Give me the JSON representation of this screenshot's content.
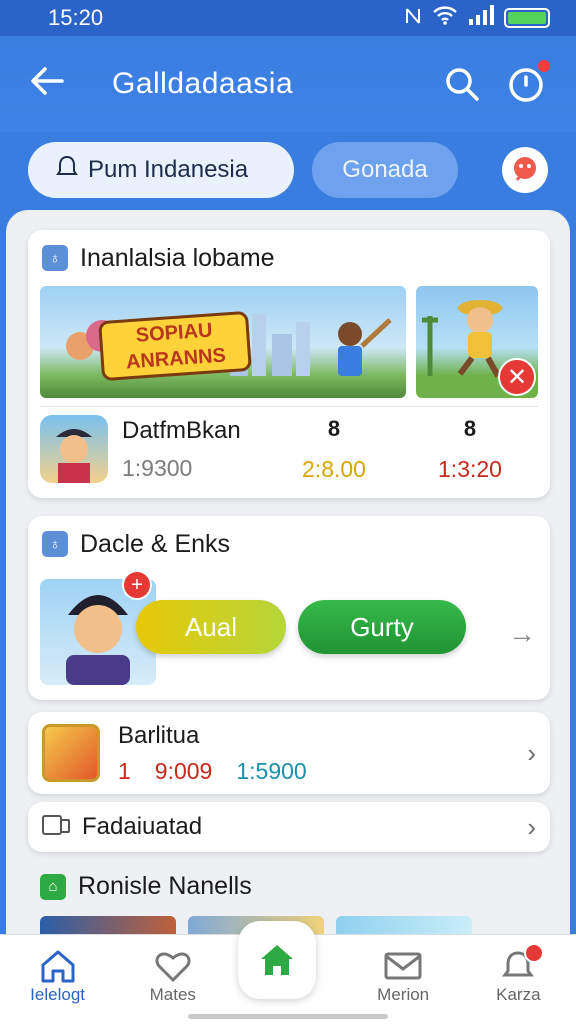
{
  "status_bar": {
    "time": "15:20",
    "icons": [
      "nfc-icon",
      "wifi-icon",
      "signal-icon",
      "battery-icon"
    ]
  },
  "app_bar": {
    "title": "Galldadaasia",
    "icons": [
      "back-arrow-icon",
      "search-icon",
      "timer-icon"
    ]
  },
  "chips": {
    "primary_label": "Pum Indanesia",
    "secondary_label": "Gonada"
  },
  "sections": {
    "featured": {
      "title": "Inanlalsia lobame",
      "banner_text_1": "SOPIAU",
      "banner_text_2": "ANRANNS",
      "game": {
        "name": "DatfmBkan",
        "value": "1:9300"
      },
      "stats": [
        {
          "top": "8",
          "bottom": "2:8.00"
        },
        {
          "top": "8",
          "bottom": "1:3:20"
        }
      ]
    },
    "deals": {
      "title": "Dacle & Enks",
      "badge": "+",
      "yellow_button": "Aual",
      "green_button": "Gurty"
    },
    "bar_item": {
      "name": "Barlitua",
      "stat_1": "1",
      "stat_2": "9:009",
      "stat_3": "1:5900"
    },
    "fadaiuatad": {
      "title": "Fadaiuatad"
    },
    "ronisle": {
      "title": "Ronisle Nanells"
    }
  },
  "bottom_nav": [
    {
      "label": "Ielelogt",
      "icon": "home-outline-icon"
    },
    {
      "label": "Mates",
      "icon": "heart-icon"
    },
    {
      "label": "",
      "icon": "home-icon"
    },
    {
      "label": "Merion",
      "icon": "mail-icon"
    },
    {
      "label": "Karza",
      "icon": "bell-icon"
    }
  ],
  "colors": {
    "brand_blue": "#3a7de0",
    "accent_green": "#2eaa44",
    "accent_yellow": "#e7c808",
    "alert_red": "#e53935"
  }
}
